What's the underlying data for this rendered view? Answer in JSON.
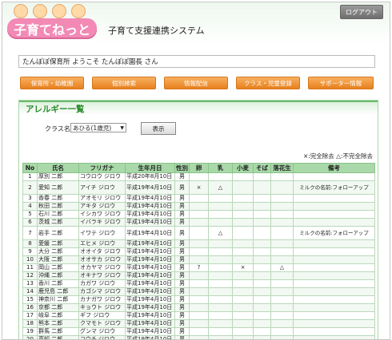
{
  "header": {
    "logo_text": "子育てねっと",
    "system_title": "子育て支援連携システム",
    "logout_label": "ログアウト"
  },
  "welcome": {
    "text": "たんぽぽ保育所 ようこそ たんぽぽ園長 さん"
  },
  "nav": [
    "保育所・幼稚園",
    "個別検索",
    "情報配信",
    "クラス・児童登録",
    "サポーター情報"
  ],
  "allergy": {
    "title": "アレルギー一覧",
    "class_label": "クラス名",
    "class_selected": "あひる(1歳児)",
    "show_button": "表示",
    "legend": "×:完全除去 △:不完全除去",
    "columns": [
      "No",
      "氏名",
      "フリガナ",
      "生年月日",
      "性別",
      "卵",
      "乳",
      "小麦",
      "そば",
      "落花生",
      "備考"
    ],
    "rows": [
      [
        "1",
        "厚別 二郎",
        "コウロウ ジロウ",
        "平成20年8月10日",
        "男",
        "",
        "",
        "",
        "",
        "",
        ""
      ],
      [
        "2",
        "愛知 二郎",
        "アイチ ジロウ",
        "平成19年4月10日",
        "男",
        "×",
        "△",
        "",
        "",
        "",
        "ミルクの名前:フォローアップ"
      ],
      [
        "3",
        "香春 二郎",
        "アオモリ ジロウ",
        "平成19年4月10日",
        "男",
        "",
        "",
        "",
        "",
        "",
        ""
      ],
      [
        "4",
        "秋田 二郎",
        "アキタ ジロウ",
        "平成19年4月10日",
        "男",
        "",
        "",
        "",
        "",
        "",
        ""
      ],
      [
        "5",
        "石川 二郎",
        "イシカワ ジロウ",
        "平成19年4月10日",
        "男",
        "",
        "",
        "",
        "",
        "",
        ""
      ],
      [
        "6",
        "茨城 二郎",
        "イバラキ ジロウ",
        "平成19年4月10日",
        "男",
        "",
        "",
        "",
        "",
        "",
        ""
      ],
      [
        "7",
        "岩手 二郎",
        "イワテ ジロウ",
        "平成19年4月10日",
        "男",
        "",
        "△",
        "",
        "",
        "",
        "ミルクの名前:フォローアップ"
      ],
      [
        "8",
        "愛媛 二郎",
        "エヒメ ジロウ",
        "平成19年4月10日",
        "男",
        "",
        "",
        "",
        "",
        "",
        ""
      ],
      [
        "9",
        "大分 二郎",
        "オオイタ ジロウ",
        "平成19年4月10日",
        "男",
        "",
        "",
        "",
        "",
        "",
        ""
      ],
      [
        "10",
        "大阪 二郎",
        "オオサカ ジロウ",
        "平成19年4月10日",
        "男",
        "",
        "",
        "",
        "",
        "",
        ""
      ],
      [
        "11",
        "岡山 二郎",
        "オカヤマ ジロウ",
        "平成19年4月10日",
        "男",
        "?",
        "",
        "×",
        "",
        "△",
        ""
      ],
      [
        "12",
        "沖縄 二郎",
        "オキナワ ジロウ",
        "平成19年4月10日",
        "男",
        "",
        "",
        "",
        "",
        "",
        ""
      ],
      [
        "13",
        "香川 二郎",
        "カガワ ジロウ",
        "平成19年4月10日",
        "男",
        "",
        "",
        "",
        "",
        "",
        ""
      ],
      [
        "14",
        "鹿児島 二郎",
        "カゴシマ ジロウ",
        "平成19年4月10日",
        "男",
        "",
        "",
        "",
        "",
        "",
        ""
      ],
      [
        "15",
        "神奈川 二郎",
        "カナガワ ジロウ",
        "平成19年4月10日",
        "男",
        "",
        "",
        "",
        "",
        "",
        ""
      ],
      [
        "16",
        "京都 二郎",
        "キョウト ジロウ",
        "平成19年4月10日",
        "男",
        "",
        "",
        "",
        "",
        "",
        ""
      ],
      [
        "17",
        "岐阜 二郎",
        "ギフ ジロウ",
        "平成19年4月10日",
        "男",
        "",
        "",
        "",
        "",
        "",
        ""
      ],
      [
        "18",
        "熊本 二郎",
        "クマモト ジロウ",
        "平成19年4月10日",
        "男",
        "",
        "",
        "",
        "",
        "",
        ""
      ],
      [
        "19",
        "群馬 二郎",
        "グンマ ジロウ",
        "平成19年4月10日",
        "男",
        "",
        "",
        "",
        "",
        "",
        ""
      ],
      [
        "20",
        "高知 二郎",
        "コウチ ジロウ",
        "平成19年4月10日",
        "男",
        "",
        "",
        "",
        "",
        "",
        ""
      ]
    ]
  }
}
